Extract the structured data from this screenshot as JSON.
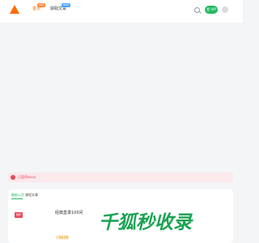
{
  "header": {
    "nav": [
      {
        "label": "首页",
        "badge": "HOT"
      },
      {
        "label": "获取文章",
        "badge": "NEW"
      }
    ],
    "vip_label": "登 VIP",
    "accent": "#ff6a00",
    "green": "#25b864"
  },
  "notice": {
    "text": "已暂停wxxx"
  },
  "panel": {
    "tabs": [
      "最新公开",
      "课程文章"
    ],
    "course": {
      "tag": "推荐",
      "title": "经典直录100问",
      "promo": "⚡ 最新优惠"
    }
  },
  "watermark": {
    "text": "千狐秒收录"
  }
}
